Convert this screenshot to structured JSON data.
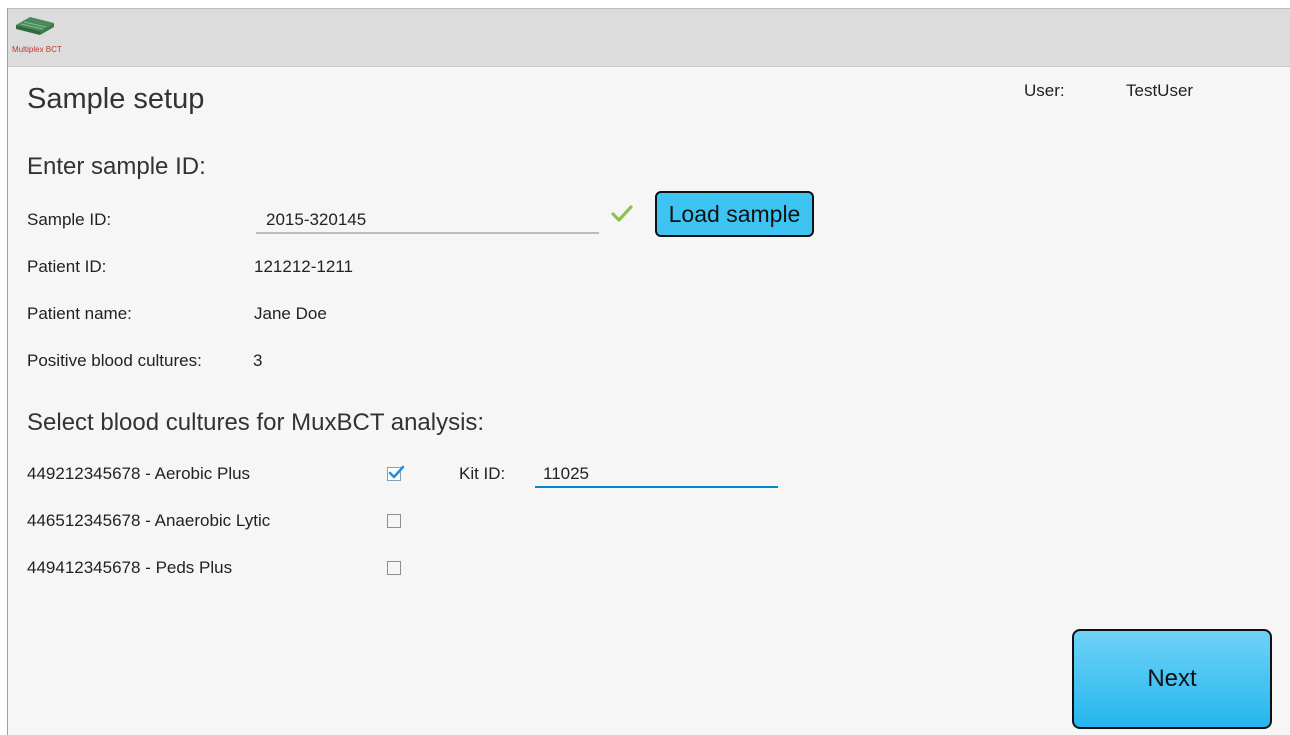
{
  "app": {
    "logo_text": "Multiplex BCT",
    "icon": "app-logo-icon"
  },
  "header": {
    "title": "Sample setup",
    "user_label": "User:",
    "user_name": "TestUser"
  },
  "sample": {
    "section_title": "Enter sample ID:",
    "sample_id_label": "Sample ID:",
    "sample_id_value": "2015-320145",
    "sample_id_valid_icon": "checkmark-icon",
    "valid_color": "#8bc34a",
    "load_button": "Load sample",
    "patient_id_label": "Patient ID:",
    "patient_id_value": "121212-1211",
    "patient_name_label": "Patient name:",
    "patient_name_value": "Jane Doe",
    "positive_cultures_label": "Positive blood cultures:",
    "positive_cultures_value": "3"
  },
  "cultures": {
    "section_title": "Select blood cultures for MuxBCT analysis:",
    "items": [
      {
        "label": "449212345678 - Aerobic Plus",
        "checked": true
      },
      {
        "label": "446512345678 - Anaerobic Lytic",
        "checked": false
      },
      {
        "label": "449412345678 - Peds Plus",
        "checked": false
      }
    ],
    "kit_id_label": "Kit ID:",
    "kit_id_value": "11025"
  },
  "footer": {
    "next_button": "Next"
  },
  "colors": {
    "accent": "#29b6f6",
    "active_field_underline": "#0288d1",
    "checkbox_check": "#2a8fd6"
  }
}
